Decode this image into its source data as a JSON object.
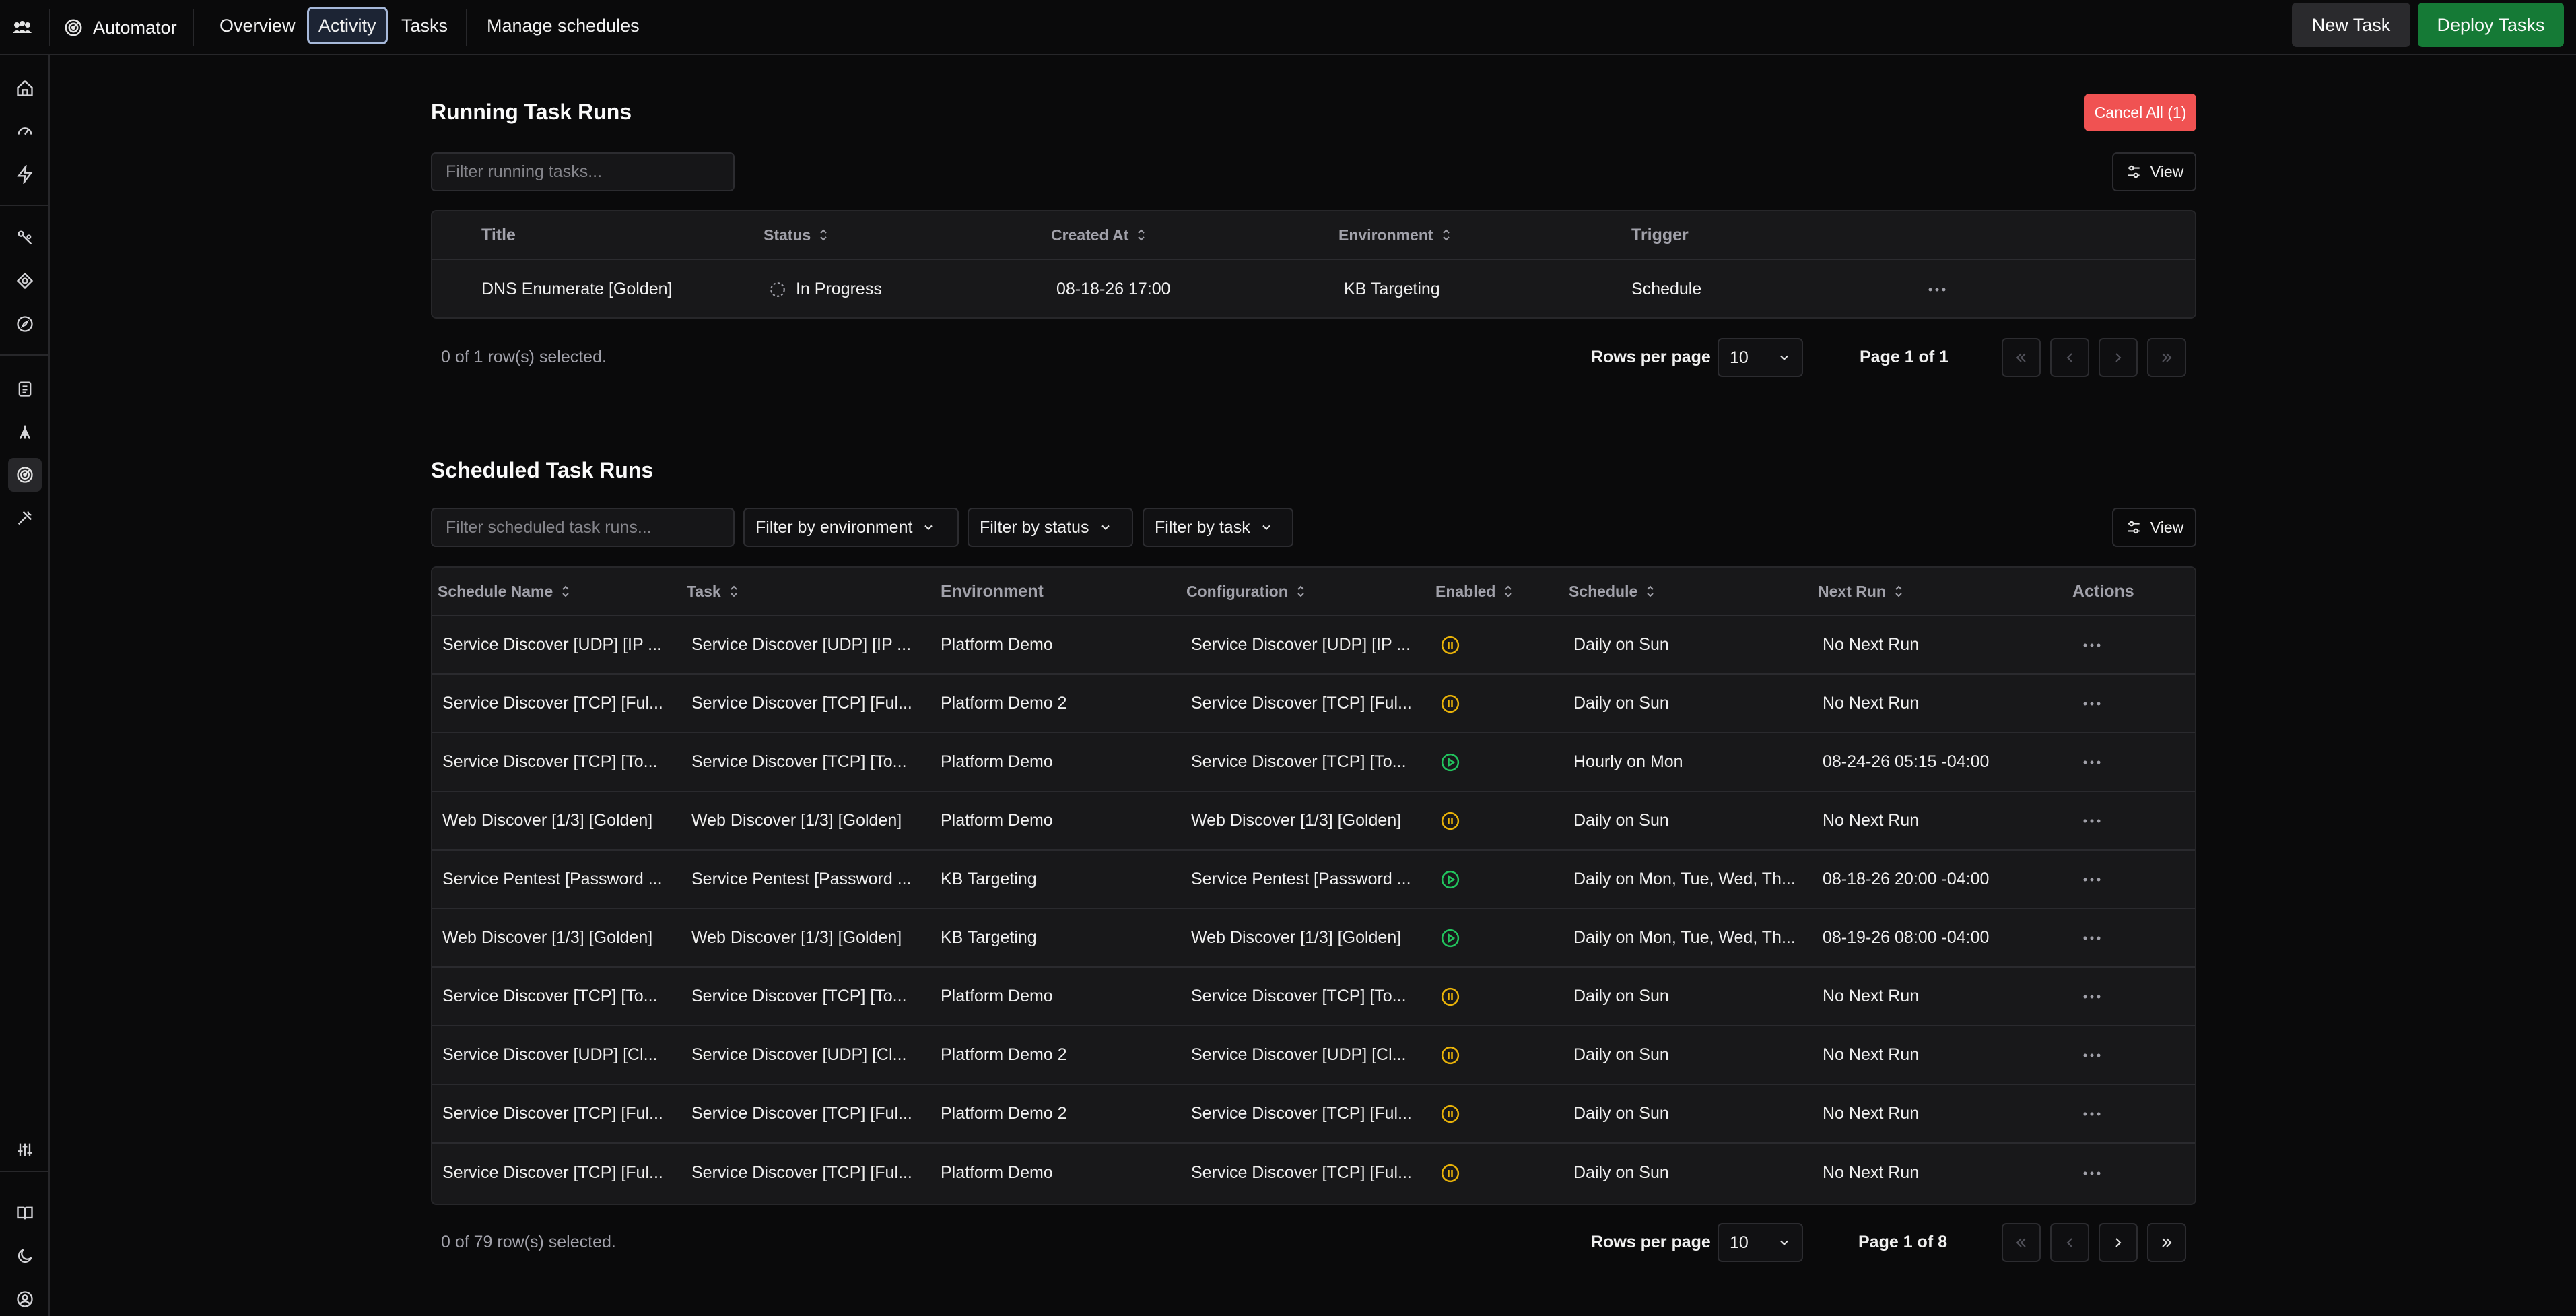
{
  "app": {
    "name": "Automator",
    "nav_tabs": [
      "Overview",
      "Activity",
      "Tasks",
      "Manage schedules"
    ],
    "active_tab": "Activity",
    "buttons": {
      "new_task": "New Task",
      "deploy_tasks": "Deploy Tasks"
    }
  },
  "rail": {
    "icons": [
      "home-icon",
      "gauge-icon",
      "bolt-icon",
      "radar-icon",
      "target-icon",
      "compass-icon",
      "clipboard-icon",
      "antenna-icon",
      "automator-icon",
      "tools-icon",
      "sliders-icon",
      "book-icon",
      "moon-icon",
      "user-icon"
    ],
    "active_icon": "automator-icon"
  },
  "running": {
    "title": "Running Task Runs",
    "cancel_all": "Cancel All (1)",
    "filter_placeholder": "Filter running tasks...",
    "view_label": "View",
    "columns": {
      "title": "Title",
      "status": "Status",
      "created_at": "Created At",
      "environment": "Environment",
      "trigger": "Trigger"
    },
    "rows": [
      {
        "title": "DNS Enumerate [Golden]",
        "status": "In Progress",
        "created_at": "08-18-26 17:00",
        "environment": "KB Targeting",
        "trigger": "Schedule"
      }
    ],
    "selected_text": "0 of 1 row(s) selected.",
    "rows_per_page_label": "Rows per page",
    "rows_per_page": "10",
    "page_text": "Page 1 of 1"
  },
  "scheduled": {
    "title": "Scheduled Task Runs",
    "filter_placeholder": "Filter scheduled task runs...",
    "filters": {
      "environment": "Filter by environment",
      "status": "Filter by status",
      "task": "Filter by task"
    },
    "view_label": "View",
    "columns": {
      "schedule_name": "Schedule Name",
      "task": "Task",
      "environment": "Environment",
      "configuration": "Configuration",
      "enabled": "Enabled",
      "schedule": "Schedule",
      "next_run": "Next Run",
      "actions": "Actions"
    },
    "rows": [
      {
        "schedule_name": "Service Discover [UDP] [IP ...",
        "task": "Service Discover [UDP] [IP ...",
        "environment": "Platform Demo",
        "configuration": "Service Discover [UDP] [IP ...",
        "enabled": "paused",
        "schedule": "Daily on Sun",
        "next_run": "No Next Run"
      },
      {
        "schedule_name": "Service Discover [TCP] [Ful...",
        "task": "Service Discover [TCP] [Ful...",
        "environment": "Platform Demo 2",
        "configuration": "Service Discover [TCP] [Ful...",
        "enabled": "paused",
        "schedule": "Daily on Sun",
        "next_run": "No Next Run"
      },
      {
        "schedule_name": "Service Discover [TCP] [To...",
        "task": "Service Discover [TCP] [To...",
        "environment": "Platform Demo",
        "configuration": "Service Discover [TCP] [To...",
        "enabled": "active",
        "schedule": "Hourly on Mon",
        "next_run": "08-24-26 05:15 -04:00"
      },
      {
        "schedule_name": "Web Discover [1/3] [Golden]",
        "task": "Web Discover [1/3] [Golden]",
        "environment": "Platform Demo",
        "configuration": "Web Discover [1/3] [Golden]",
        "enabled": "paused",
        "schedule": "Daily on Sun",
        "next_run": "No Next Run"
      },
      {
        "schedule_name": "Service Pentest [Password ...",
        "task": "Service Pentest [Password ...",
        "environment": "KB Targeting",
        "configuration": "Service Pentest [Password ...",
        "enabled": "active",
        "schedule": "Daily on Mon, Tue, Wed, Th...",
        "next_run": "08-18-26 20:00 -04:00"
      },
      {
        "schedule_name": "Web Discover [1/3] [Golden]",
        "task": "Web Discover [1/3] [Golden]",
        "environment": "KB Targeting",
        "configuration": "Web Discover [1/3] [Golden]",
        "enabled": "active",
        "schedule": "Daily on Mon, Tue, Wed, Th...",
        "next_run": "08-19-26 08:00 -04:00"
      },
      {
        "schedule_name": "Service Discover [TCP] [To...",
        "task": "Service Discover [TCP] [To...",
        "environment": "Platform Demo",
        "configuration": "Service Discover [TCP] [To...",
        "enabled": "paused",
        "schedule": "Daily on Sun",
        "next_run": "No Next Run"
      },
      {
        "schedule_name": "Service Discover [UDP] [Cl...",
        "task": "Service Discover [UDP] [Cl...",
        "environment": "Platform Demo 2",
        "configuration": "Service Discover [UDP] [Cl...",
        "enabled": "paused",
        "schedule": "Daily on Sun",
        "next_run": "No Next Run"
      },
      {
        "schedule_name": "Service Discover [TCP] [Ful...",
        "task": "Service Discover [TCP] [Ful...",
        "environment": "Platform Demo 2",
        "configuration": "Service Discover [TCP] [Ful...",
        "enabled": "paused",
        "schedule": "Daily on Sun",
        "next_run": "No Next Run"
      },
      {
        "schedule_name": "Service Discover [TCP] [Ful...",
        "task": "Service Discover [TCP] [Ful...",
        "environment": "Platform Demo",
        "configuration": "Service Discover [TCP] [Ful...",
        "enabled": "paused",
        "schedule": "Daily on Sun",
        "next_run": "No Next Run"
      }
    ],
    "selected_text": "0 of 79 row(s) selected.",
    "rows_per_page_label": "Rows per page",
    "rows_per_page": "10",
    "page_text": "Page 1 of 8"
  },
  "colors": {
    "accent_green": "#157a36",
    "danger": "#f05252",
    "enabled_active": "#22c55e",
    "enabled_paused": "#eab308"
  }
}
